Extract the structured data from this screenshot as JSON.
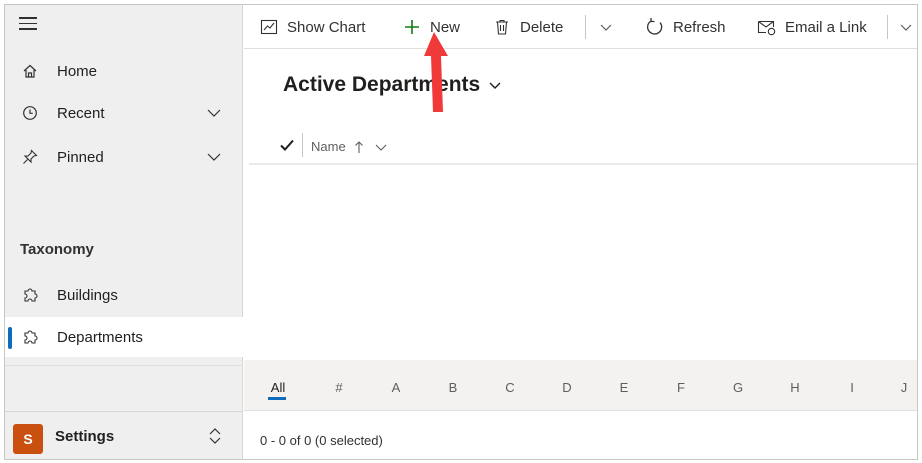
{
  "sidebar": {
    "nav": [
      {
        "label": "Home",
        "icon": "home-icon"
      },
      {
        "label": "Recent",
        "icon": "clock-icon"
      },
      {
        "label": "Pinned",
        "icon": "pin-icon"
      }
    ],
    "section_title": "Taxonomy",
    "entities": [
      {
        "label": "Buildings",
        "icon": "puzzle-icon",
        "selected": false
      },
      {
        "label": "Departments",
        "icon": "puzzle-icon",
        "selected": true
      }
    ],
    "area": {
      "avatar": "S",
      "label": "Settings"
    }
  },
  "toolbar": {
    "show_chart": "Show Chart",
    "new": "New",
    "delete": "Delete",
    "refresh": "Refresh",
    "email_link": "Email a Link"
  },
  "view": {
    "title": "Active Departments",
    "column_name": "Name"
  },
  "alphabet": [
    "All",
    "#",
    "A",
    "B",
    "C",
    "D",
    "E",
    "F",
    "G",
    "H",
    "I",
    "J"
  ],
  "footer": {
    "status": "0 - 0 of 0 (0 selected)"
  },
  "colors": {
    "accent": "#0f6cbd",
    "avatar": "#ca5010",
    "annotation_arrow": "#f03a3a"
  }
}
